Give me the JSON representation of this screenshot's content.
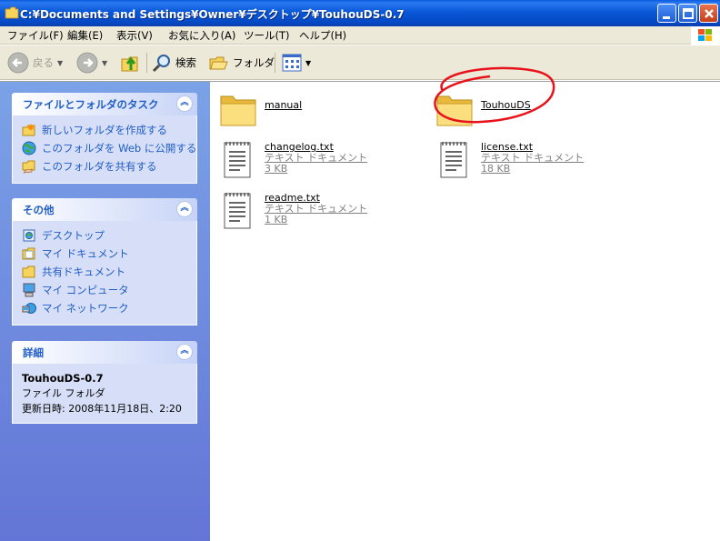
{
  "window": {
    "title": "C:¥Documents and Settings¥Owner¥デスクトップ¥TouhouDS-0.7"
  },
  "menu": [
    "ファイル(F)",
    "編集(E)",
    "表示(V)",
    "お気に入り(A)",
    "ツール(T)",
    "ヘルプ(H)"
  ],
  "toolbar": {
    "back": "戻る",
    "search": "検索",
    "folders": "フォルダ"
  },
  "tasks_panel": {
    "title": "ファイルとフォルダのタスク",
    "items": [
      "新しいフォルダを作成する",
      "このフォルダを Web に公開する",
      "このフォルダを共有する"
    ]
  },
  "other_panel": {
    "title": "その他",
    "items": [
      "デスクトップ",
      "マイ ドキュメント",
      "共有ドキュメント",
      "マイ コンピュータ",
      "マイ ネットワーク"
    ]
  },
  "details_panel": {
    "title": "詳細",
    "name": "TouhouDS-0.7",
    "type": "ファイル フォルダ",
    "modified": "更新日時: 2008年11月18日、2:20"
  },
  "files": [
    {
      "name": "manual",
      "kind": "folder"
    },
    {
      "name": "TouhouDS",
      "kind": "folder"
    },
    {
      "name": "changelog.txt",
      "type": "テキスト ドキュメント",
      "size": "3 KB",
      "kind": "text"
    },
    {
      "name": "license.txt",
      "type": "テキスト ドキュメント",
      "size": "18 KB",
      "kind": "text"
    },
    {
      "name": "readme.txt",
      "type": "テキスト ドキュメント",
      "size": "1 KB",
      "kind": "text"
    }
  ],
  "colors": {
    "titlebar": "#0a58d8",
    "sidepanel_link": "#215dc6",
    "annotation_circle": "#e8121b"
  }
}
